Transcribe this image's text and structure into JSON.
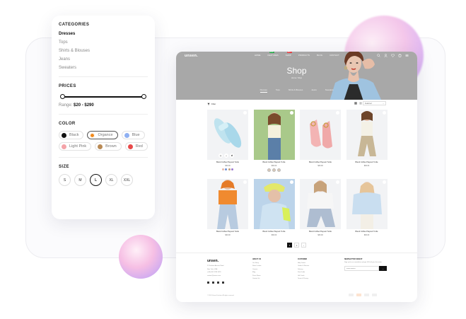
{
  "filters": {
    "categories_title": "CATEGORIES",
    "categories": [
      "Dresses",
      "Tops",
      "Shirts & Blouses",
      "Jeans",
      "Sweaters"
    ],
    "active_category": "Dresses",
    "prices_title": "PRICES",
    "range_label": "Range:",
    "range_value": "$20 - $290",
    "color_title": "COLOR",
    "colors": [
      {
        "name": "Black",
        "hex": "#111111"
      },
      {
        "name": "Organce",
        "hex": "#f28a1b"
      },
      {
        "name": "Blue",
        "hex": "#8fb0f2"
      },
      {
        "name": "Light Pink",
        "hex": "#f4a3a8"
      },
      {
        "name": "Brown",
        "hex": "#b98a55"
      },
      {
        "name": "Red",
        "hex": "#e84a4a"
      }
    ],
    "active_color": "Organce",
    "size_title": "SIZE",
    "sizes": [
      "S",
      "M",
      "L",
      "XL",
      "XXL"
    ],
    "active_size": "L"
  },
  "site": {
    "logo": "unsen.",
    "nav": [
      {
        "label": "HOME",
        "badge": ""
      },
      {
        "label": "FEATURES",
        "badge": "NEW"
      },
      {
        "label": "SHOP",
        "badge": "HOT"
      },
      {
        "label": "PRODUCTS",
        "badge": ""
      },
      {
        "label": "BLOG",
        "badge": ""
      },
      {
        "label": "CONTACT",
        "badge": ""
      }
    ],
    "hero_title": "Shop",
    "breadcrumb": "Home  /  Shop",
    "category_tabs": [
      "Dresses",
      "Tops",
      "Shirts & Blouses",
      "Jeans",
      "Sweaters"
    ],
    "active_tab": "Dresses",
    "filter_label": "Filter",
    "sort_label": "Featured"
  },
  "products": [
    {
      "name": "Blend Coffee Playsuit Turtle",
      "price": "$30.00",
      "swatches": [
        "#e8b8a8",
        "#6b8fd8",
        "#c6a07a",
        "#9c7bd0"
      ],
      "thumbs": 0
    },
    {
      "name": "Blend Coffee Playsuit Turtle",
      "price": "$30.00",
      "swatches": [],
      "thumbs": 3
    },
    {
      "name": "Blend Coffee Playsuit Turtle",
      "price": "$30.00",
      "swatches": [],
      "thumbs": 0
    },
    {
      "name": "Blend Coffee Playsuit Turtle",
      "price": "$30.00",
      "swatches": [],
      "thumbs": 0
    },
    {
      "name": "Blend Coffee Playsuit Turtle",
      "price": "$30.00",
      "swatches": [],
      "thumbs": 0
    },
    {
      "name": "Blend Coffee Playsuit Turtle",
      "price": "$30.00",
      "swatches": [],
      "thumbs": 0
    },
    {
      "name": "Blend Coffee Playsuit Turtle",
      "price": "$30.00",
      "swatches": [],
      "thumbs": 0
    },
    {
      "name": "Blend Coffee Playsuit Turtle",
      "price": "$30.00",
      "swatches": [],
      "thumbs": 0
    }
  ],
  "pagination": [
    "1",
    "2",
    "›"
  ],
  "footer": {
    "logo": "unsen.",
    "address": [
      "12 Fashion Avenue Road",
      "New York, USA",
      "(+00) 000 1234 5678",
      "contact@unsen.com"
    ],
    "col1_title": "ABOUT US",
    "col1_items": [
      "Our Story",
      "Store Locator",
      "Careers",
      "Blog",
      "Press Room",
      "Contact Us"
    ],
    "col2_title": "CUSTOMER",
    "col2_items": [
      "Help Center",
      "Orders & Returns",
      "Delivery",
      "Size Guide",
      "Gift Cards",
      "Terms & Privacy"
    ],
    "news_title": "NEWSLETTER SIGNUP",
    "news_text": "Sign up for our newsletter and get 10% off your first order.",
    "news_placeholder": "Email address",
    "news_button": "→",
    "copyright": "© 2024 Unsen Fashion. All rights reserved."
  }
}
